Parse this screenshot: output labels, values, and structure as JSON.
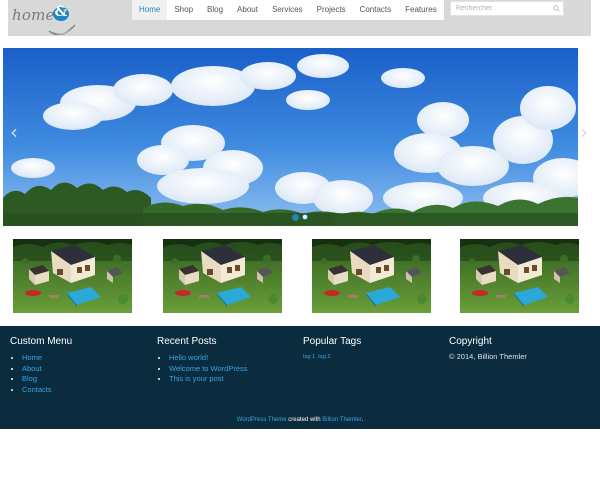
{
  "header": {
    "logo_text": "home",
    "logo_mark": "&",
    "nav": [
      "Home",
      "Shop",
      "Blog",
      "About",
      "Services",
      "Projects",
      "Contacts",
      "Features"
    ],
    "active_nav": "Home",
    "search_placeholder": "Rechercher"
  },
  "slider": {
    "prev_arrow": "‹",
    "next_arrow": "›",
    "slide_count": 2,
    "active_slide": 1
  },
  "thumbnails": [
    {
      "icon": "house-image"
    },
    {
      "icon": "house-image"
    },
    {
      "icon": "house-image"
    },
    {
      "icon": "house-image"
    }
  ],
  "footer": {
    "custom_menu": {
      "title": "Custom Menu",
      "items": [
        "Home",
        "About",
        "Blog",
        "Contacts"
      ]
    },
    "recent_posts": {
      "title": "Recent Posts",
      "items": [
        "Hello world!",
        "Welcome to WordPress",
        "This is your post"
      ]
    },
    "popular_tags": {
      "title": "Popular Tags",
      "tags": [
        "tag 1",
        "tag 2"
      ]
    },
    "copyright": {
      "title": "Copyright",
      "text": "© 2014, Billion Themler"
    },
    "credit": {
      "theme_link": "WordPress Theme",
      "middle": " created with ",
      "author_link": "Billion Themler",
      "end": "."
    }
  },
  "colors": {
    "accent": "#1e8bc3",
    "footer_bg": "#0b2b3f",
    "header_bg": "#d8d8d8",
    "link": "#35a7e0"
  }
}
